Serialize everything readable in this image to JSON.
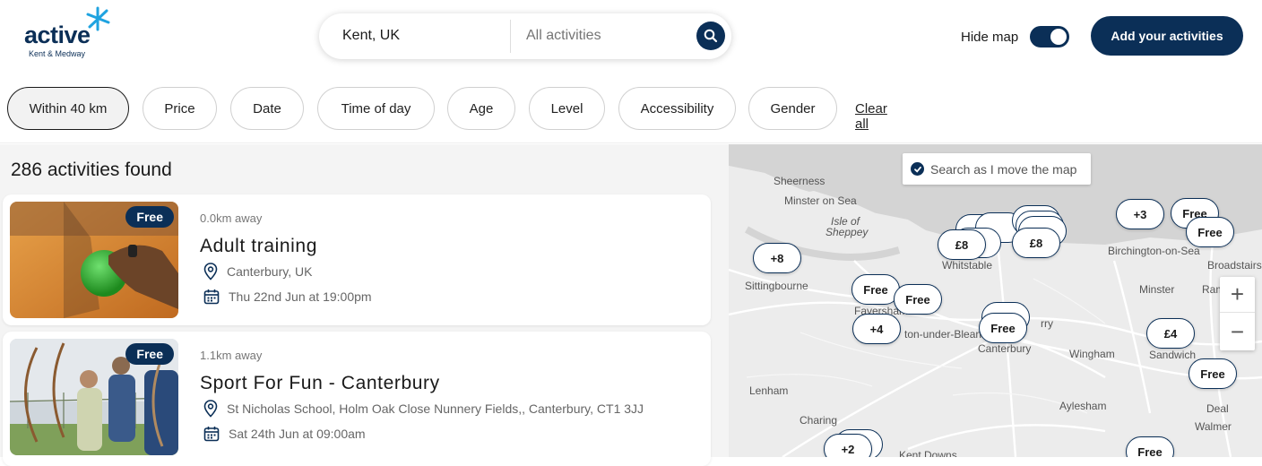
{
  "header": {
    "logo_text": "active",
    "logo_subtitle": "Kent & Medway",
    "search_location": "Kent, UK",
    "search_placeholder": "All activities",
    "hide_map_label": "Hide map",
    "hide_map_on": true,
    "add_button_label": "Add your activities"
  },
  "filters": {
    "chips": [
      "Within 40 km",
      "Price",
      "Date",
      "Time of day",
      "Age",
      "Level",
      "Accessibility",
      "Gender"
    ],
    "clear_all": "Clear all"
  },
  "results": {
    "count_text": "286 activities found",
    "items": [
      {
        "badge": "Free",
        "distance": "0.0km away",
        "title": "Adult training",
        "location": "Canterbury, UK",
        "datetime": "Thu 22nd Jun at 19:00pm"
      },
      {
        "badge": "Free",
        "distance": "1.1km away",
        "title": "Sport For Fun - Canterbury",
        "location": "St Nicholas School, Holm Oak Close Nunnery Fields,, Canterbury, CT1 3JJ",
        "datetime": "Sat 24th Jun at 09:00am"
      }
    ]
  },
  "map": {
    "search_as_move": "Search as I move the map",
    "zoom_in": "+",
    "zoom_out": "−",
    "places": [
      "Sheerness",
      "Minster on Sea",
      "Isle of",
      "Sheppey",
      "Whitstable",
      "Birchington-on-Sea",
      "Broadstairs",
      "Sittingbourne",
      "Faversham",
      "Minster",
      "Ram",
      "ton-under-Blean",
      "Canterbury",
      "Wingham",
      "Sandwich",
      "Lenham",
      "Aylesham",
      "Deal",
      "Charing",
      "Walmer",
      "Kent Downs",
      "rry"
    ],
    "pins": [
      "+8",
      "£8",
      "£8",
      "+3",
      "Free",
      "Free",
      "Free",
      "Free",
      "+4",
      "Free",
      "£4",
      "Free",
      "+2",
      "Free"
    ]
  },
  "colors": {
    "brand": "#0b2f57",
    "accent_star": "#1fa3e0"
  }
}
